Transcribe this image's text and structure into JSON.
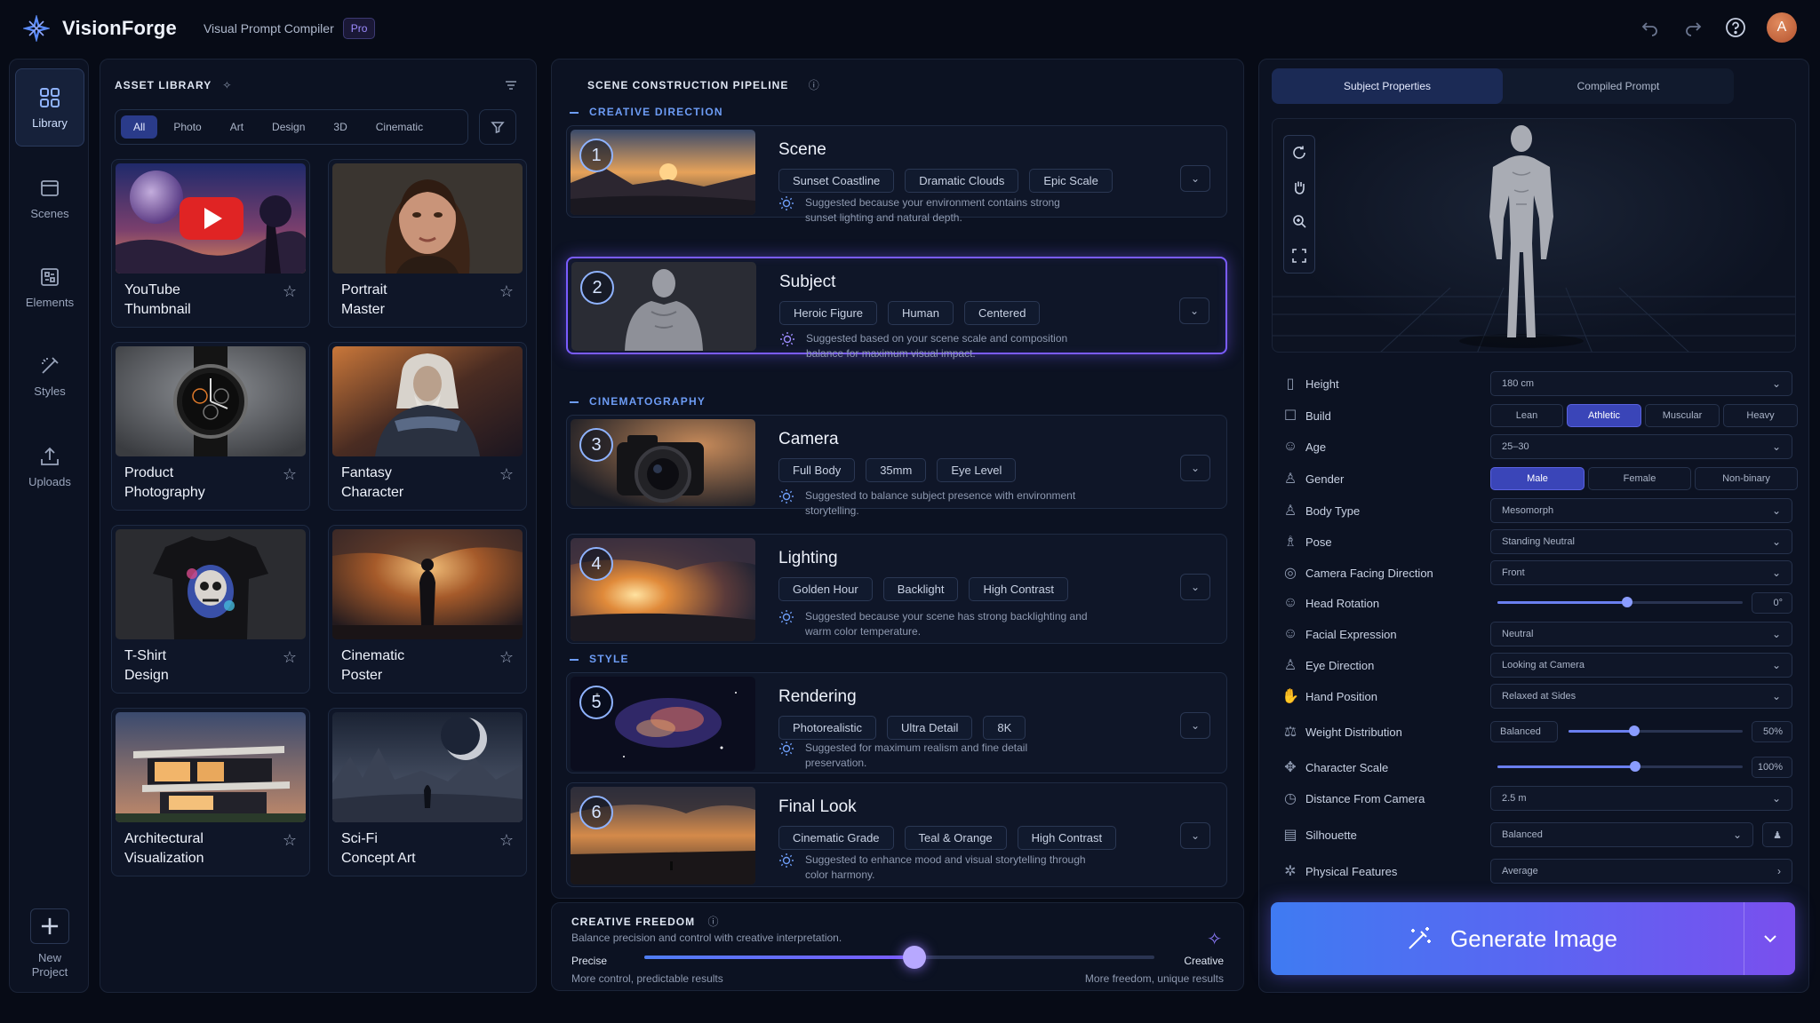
{
  "app": {
    "name": "VisionForge",
    "subtitle": "Visual Prompt Compiler",
    "badge": "Pro",
    "avatar_initial": "A"
  },
  "nav": [
    {
      "label": "Library",
      "icon": "grid-icon",
      "active": true
    },
    {
      "label": "Scenes",
      "icon": "scenes-icon"
    },
    {
      "label": "Elements",
      "icon": "elements-icon"
    },
    {
      "label": "Styles",
      "icon": "styles-icon"
    },
    {
      "label": "Uploads",
      "icon": "upload-icon"
    }
  ],
  "new_project": {
    "line1": "New",
    "line2": "Project"
  },
  "library": {
    "title": "ASSET LIBRARY",
    "filters": [
      "All",
      "Photo",
      "Art",
      "Design",
      "3D",
      "Cinematic"
    ],
    "active_filter": "All",
    "cards": [
      {
        "line1": "YouTube",
        "line2": "Thumbnail"
      },
      {
        "line1": "Portrait",
        "line2": "Master"
      },
      {
        "line1": "Product",
        "line2": "Photography"
      },
      {
        "line1": "Fantasy",
        "line2": "Character"
      },
      {
        "line1": "T-Shirt",
        "line2": "Design"
      },
      {
        "line1": "Cinematic",
        "line2": "Poster"
      },
      {
        "line1": "Architectural",
        "line2": "Visualization"
      },
      {
        "line1": "Sci-Fi",
        "line2": "Concept Art"
      }
    ]
  },
  "pipeline": {
    "title": "SCENE CONSTRUCTION PIPELINE",
    "sections": {
      "creative": "CREATIVE DIRECTION",
      "cinema": "CINEMATOGRAPHY",
      "style": "STYLE"
    },
    "steps": [
      {
        "num": "1",
        "title": "Scene",
        "tags": [
          "Sunset Coastline",
          "Dramatic Clouds",
          "Epic Scale"
        ],
        "suggestion": "Suggested because your environment contains strong sunset lighting and natural depth."
      },
      {
        "num": "2",
        "title": "Subject",
        "tags": [
          "Heroic Figure",
          "Human",
          "Centered"
        ],
        "suggestion": "Suggested based on your scene scale and composition balance for maximum visual impact."
      },
      {
        "num": "3",
        "title": "Camera",
        "tags": [
          "Full Body",
          "35mm",
          "Eye Level"
        ],
        "suggestion": "Suggested to balance subject presence with environment storytelling."
      },
      {
        "num": "4",
        "title": "Lighting",
        "tags": [
          "Golden Hour",
          "Backlight",
          "High Contrast"
        ],
        "suggestion": "Suggested because your scene has strong backlighting and warm color temperature."
      },
      {
        "num": "5",
        "title": "Rendering",
        "tags": [
          "Photorealistic",
          "Ultra Detail",
          "8K"
        ],
        "suggestion": "Suggested for maximum realism and fine detail preservation."
      },
      {
        "num": "6",
        "title": "Final Look",
        "tags": [
          "Cinematic Grade",
          "Teal & Orange",
          "High Contrast"
        ],
        "suggestion": "Suggested to enhance mood and visual storytelling through color harmony."
      }
    ]
  },
  "freedom": {
    "title": "CREATIVE FREEDOM",
    "subtitle": "Balance precision and control with creative interpretation.",
    "left_label": "Precise",
    "left_sub": "More control, predictable results",
    "right_label": "Creative",
    "right_sub": "More freedom, unique results",
    "value": 0.53
  },
  "properties": {
    "tabs": [
      "Subject Properties",
      "Compiled Prompt"
    ],
    "height": {
      "label": "Height",
      "value": "180 cm"
    },
    "build": {
      "label": "Build",
      "options": [
        "Lean",
        "Athletic",
        "Muscular",
        "Heavy"
      ],
      "selected": "Athletic"
    },
    "age": {
      "label": "Age",
      "value": "25–30"
    },
    "gender": {
      "label": "Gender",
      "options": [
        "Male",
        "Female",
        "Non-binary"
      ],
      "selected": "Male"
    },
    "body_type": {
      "label": "Body Type",
      "value": "Mesomorph"
    },
    "pose": {
      "label": "Pose",
      "value": "Standing Neutral"
    },
    "facing": {
      "label": "Camera Facing Direction",
      "value": "Front"
    },
    "head_rotation": {
      "label": "Head Rotation",
      "value": "0°",
      "level": 0.53
    },
    "expression": {
      "label": "Facial Expression",
      "value": "Neutral"
    },
    "eye_direction": {
      "label": "Eye Direction",
      "value": "Looking at Camera"
    },
    "hand_position": {
      "label": "Hand Position",
      "value": "Relaxed at Sides"
    },
    "weight": {
      "label": "Weight Distribution",
      "chip": "Balanced",
      "value": "50%",
      "level": 0.38
    },
    "scale": {
      "label": "Character Scale",
      "value": "100%",
      "level": 0.56
    },
    "distance": {
      "label": "Distance From Camera",
      "value": "2.5 m"
    },
    "silhouette": {
      "label": "Silhouette",
      "value": "Balanced"
    },
    "physical": {
      "label": "Physical Features",
      "value": "Average"
    }
  },
  "generate": {
    "label": "Generate Image"
  }
}
